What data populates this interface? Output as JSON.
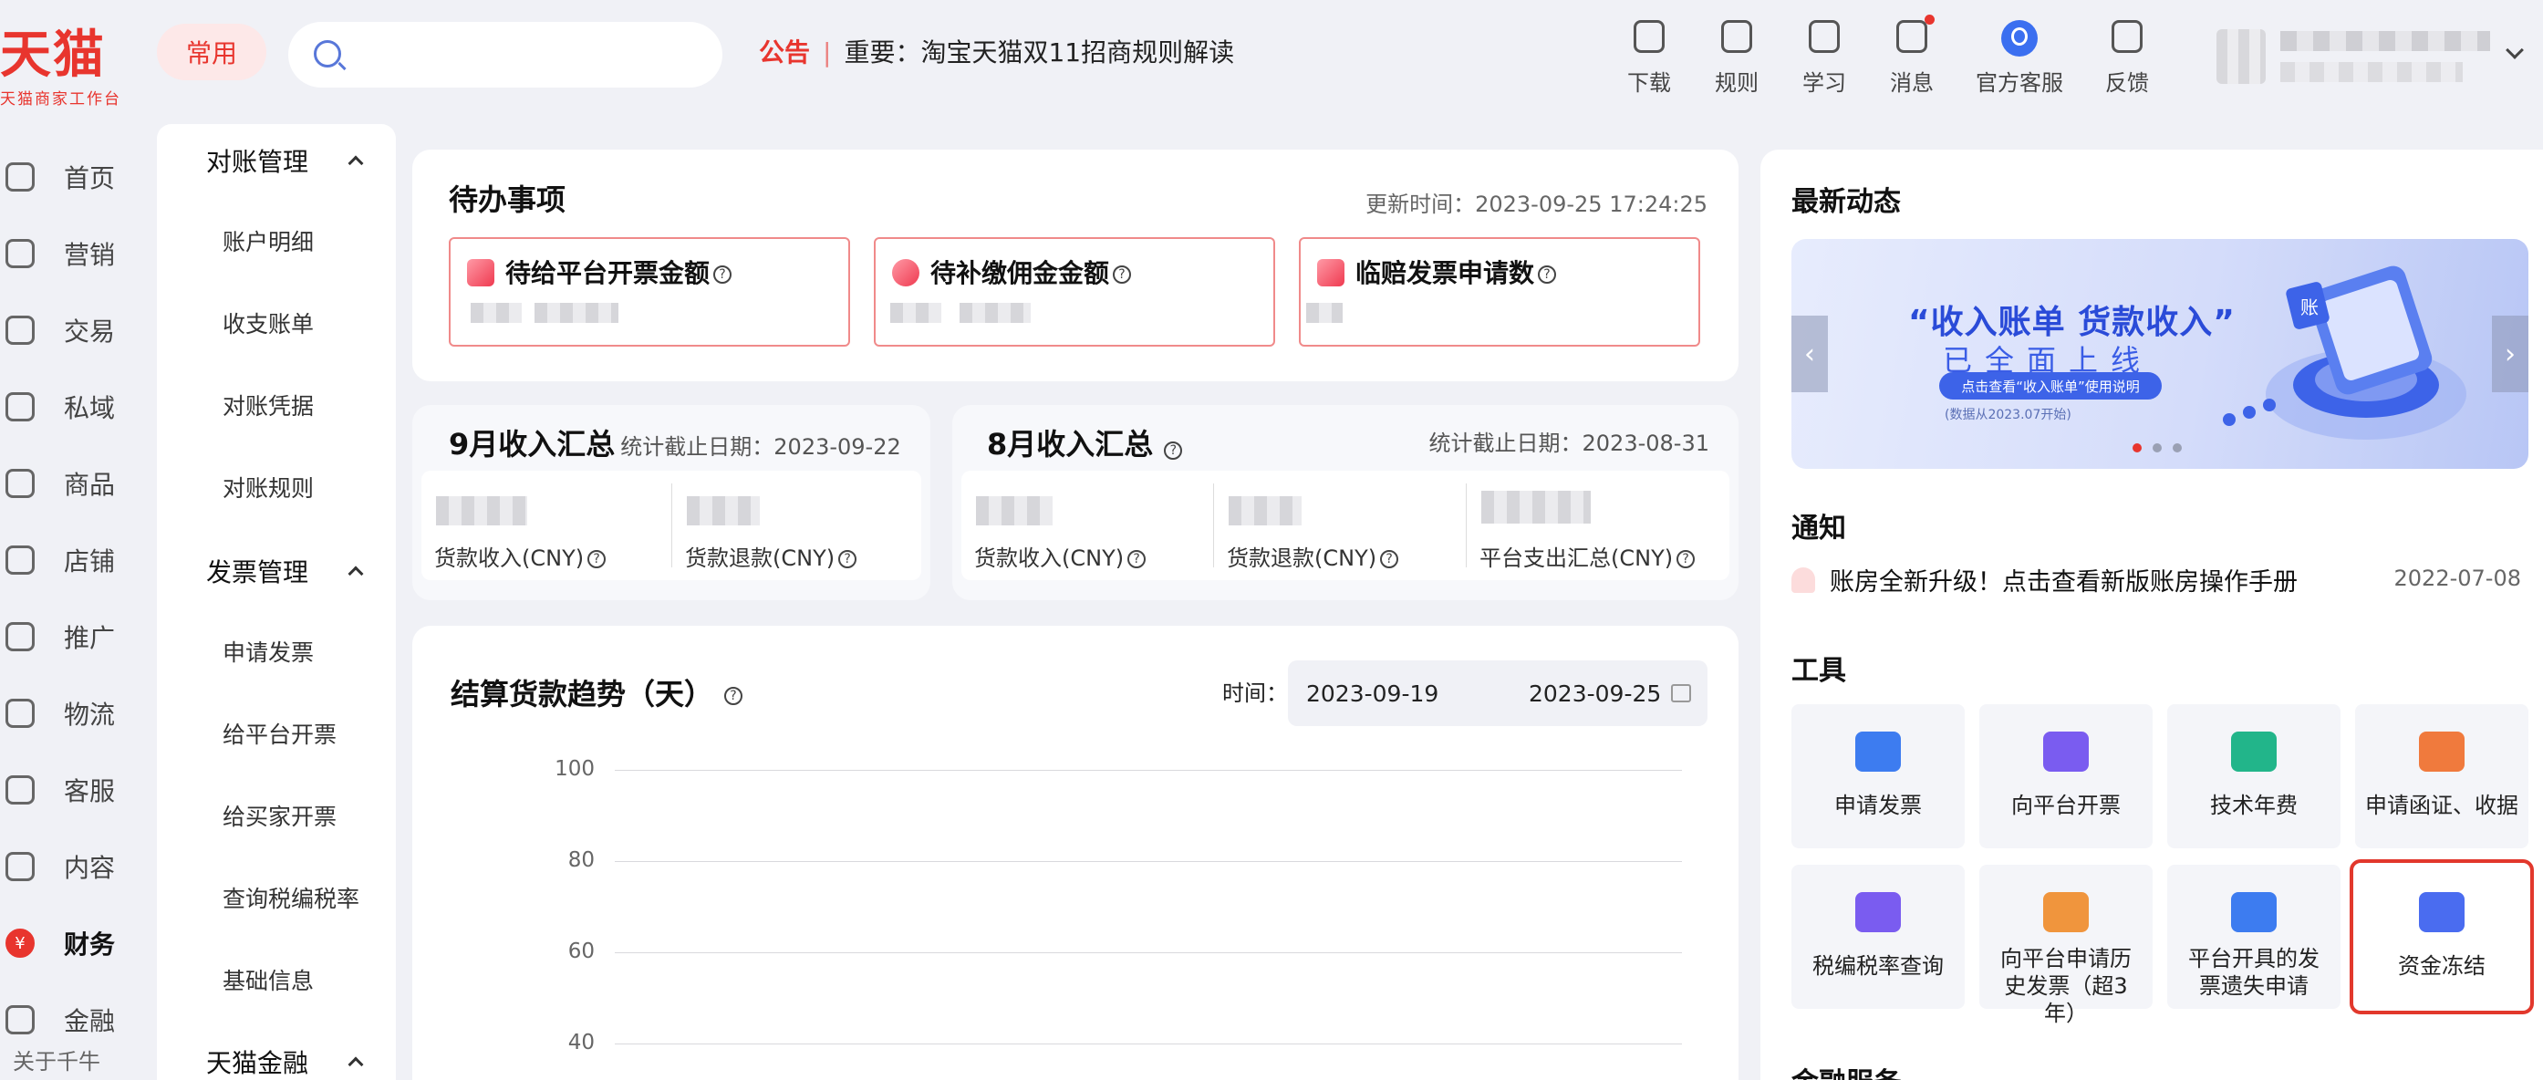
{
  "logo": {
    "main": "天猫",
    "sub": "天猫商家工作台"
  },
  "topbar": {
    "chip": "常用",
    "search_placeholder": "",
    "notice_tag": "公告",
    "notice_sep": "|",
    "notice_text": "重要：淘宝天猫双11招商规则解读",
    "nav": [
      {
        "label": "下载",
        "icon": "download-icon"
      },
      {
        "label": "规则",
        "icon": "rules-icon"
      },
      {
        "label": "学习",
        "icon": "learn-icon"
      },
      {
        "label": "消息",
        "icon": "message-icon"
      },
      {
        "label": "官方客服",
        "icon": "service-icon"
      },
      {
        "label": "反馈",
        "icon": "feedback-icon"
      }
    ]
  },
  "rail": {
    "items": [
      {
        "label": "首页",
        "icon": "home-icon"
      },
      {
        "label": "营销",
        "icon": "megaphone-icon"
      },
      {
        "label": "交易",
        "icon": "trade-icon"
      },
      {
        "label": "私域",
        "icon": "users-icon"
      },
      {
        "label": "商品",
        "icon": "product-icon"
      },
      {
        "label": "店铺",
        "icon": "store-icon"
      },
      {
        "label": "推广",
        "icon": "promote-icon"
      },
      {
        "label": "物流",
        "icon": "truck-icon"
      },
      {
        "label": "客服",
        "icon": "headset-icon"
      },
      {
        "label": "内容",
        "icon": "content-icon"
      },
      {
        "label": "财务",
        "icon": "finance-icon",
        "symbol": "¥"
      },
      {
        "label": "金融",
        "icon": "fintech-icon"
      }
    ],
    "footer": "关于千牛"
  },
  "submenu": {
    "groups": [
      {
        "title": "对账管理",
        "items": [
          "账户明细",
          "收支账单",
          "对账凭据",
          "对账规则"
        ]
      },
      {
        "title": "发票管理",
        "items": [
          "申请发票",
          "给平台开票",
          "给买家开票",
          "查询税编税率",
          "基础信息"
        ]
      },
      {
        "title": "天猫金融",
        "items": []
      }
    ]
  },
  "todo": {
    "title": "待办事项",
    "update": "更新时间：2023-09-25 17:24:25",
    "boxes": [
      {
        "title": "待给平台开票金额"
      },
      {
        "title": "待补缴佣金金额"
      },
      {
        "title": "临赔发票申请数"
      }
    ]
  },
  "summary_sep": {
    "title": "9月收入汇总",
    "date": "统计截止日期：2023-09-22",
    "cols": [
      "货款收入(CNY)",
      "货款退款(CNY)"
    ]
  },
  "summary_aug": {
    "title": "8月收入汇总",
    "date": "统计截止日期：2023-08-31",
    "cols": [
      "货款收入(CNY)",
      "货款退款(CNY)",
      "平台支出汇总(CNY)"
    ]
  },
  "trend": {
    "title": "结算货款趋势（天）",
    "time_label": "时间：",
    "date_from": "2023-09-19",
    "date_to": "2023-09-25"
  },
  "chart_data": {
    "type": "line",
    "title": "结算货款趋势（天）",
    "ylim": [
      40,
      100
    ],
    "yticks": [
      "100",
      "80",
      "60",
      "40"
    ],
    "series": []
  },
  "news": {
    "title": "最新动态",
    "banner_h1": "“收入账单 货款收入”",
    "banner_h2": "已全面上线",
    "banner_btn": "点击查看“收入账单”使用说明",
    "banner_note": "(数据从2023.07开始)",
    "banner_art_glyph": "账"
  },
  "notice": {
    "title": "通知",
    "text": "账房全新升级！点击查看新版账房操作手册",
    "date": "2022-07-08"
  },
  "tools": {
    "title": "工具",
    "items": [
      {
        "label": "申请发票",
        "icon": "invoice-apply-icon",
        "color": "#3d7cf0"
      },
      {
        "label": "向平台开票",
        "icon": "platform-invoice-icon",
        "color": "#7a5cf0"
      },
      {
        "label": "技术年费",
        "icon": "annual-fee-icon",
        "color": "#22b58a"
      },
      {
        "label": "申请函证、收据",
        "icon": "receipt-icon",
        "color": "#f07a3d"
      },
      {
        "label": "税编税率查询",
        "icon": "tax-query-icon",
        "color": "#7a5cf0"
      },
      {
        "label": "向平台申请历史发票（超3年）",
        "icon": "history-invoice-icon",
        "color": "#f0953d"
      },
      {
        "label": "平台开具的发票遗失申请",
        "icon": "lost-invoice-icon",
        "color": "#3d7cf0"
      },
      {
        "label": "资金冻结",
        "icon": "freeze-icon",
        "color": "#4a6cf0"
      }
    ]
  },
  "finance_service": {
    "title": "金融服务"
  }
}
